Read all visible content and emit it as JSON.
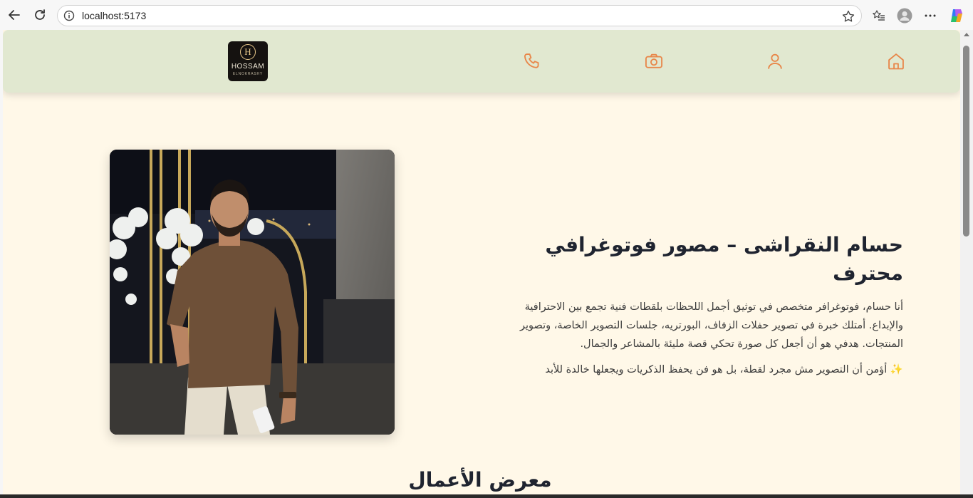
{
  "browser": {
    "url": "localhost:5173",
    "icons": [
      "back-arrow-icon",
      "reload-icon",
      "info-icon",
      "star-icon",
      "favorites-icon",
      "profile-icon",
      "more-icon",
      "copilot-icon"
    ]
  },
  "site": {
    "logo": {
      "monogram": "H",
      "name": "HOSSAM",
      "sub": "ELNOKRASHY"
    },
    "nav_icons": [
      "home-icon",
      "user-icon",
      "camera-icon",
      "phone-icon"
    ],
    "accent_color": "#e8874a",
    "header_color": "#e1e8d0",
    "background_color": "#fff8e8"
  },
  "about": {
    "title": "حسام النقراشى – مصور فوتوغرافي محترف",
    "paragraph": "أنا حسام، فوتوغرافر متخصص في توثيق أجمل اللحظات بلقطات فنية تجمع بين الاحترافية والإبداع. أمتلك خبرة في تصوير حفلات الزفاف، البورتريه، جلسات التصوير الخاصة، وتصوير المنتجات. هدفي هو أن أجعل كل صورة تحكي قصة مليئة بالمشاعر والجمال.",
    "quote": "✨ أؤمن أن التصوير مش مجرد لقطة، بل هو فن يحفظ الذكريات ويجعلها خالدة للأبد"
  },
  "gallery": {
    "title": "معرض الأعمال"
  }
}
